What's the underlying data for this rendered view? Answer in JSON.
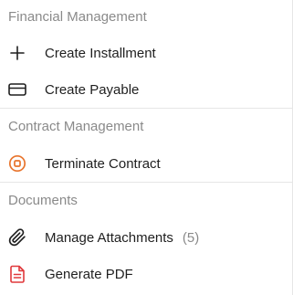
{
  "sections": [
    {
      "header": "Financial Management",
      "items": [
        {
          "label": "Create Installment",
          "icon": "plus-icon"
        },
        {
          "label": "Create Payable",
          "icon": "credit-card-icon"
        }
      ]
    },
    {
      "header": "Contract Management",
      "items": [
        {
          "label": "Terminate Contract",
          "icon": "stop-circle-icon",
          "icon_color": "#e8742c"
        }
      ]
    },
    {
      "header": "Documents",
      "items": [
        {
          "label": "Manage Attachments",
          "count": "(5)",
          "icon": "paperclip-icon"
        },
        {
          "label": "Generate PDF",
          "icon": "file-text-icon",
          "icon_color": "#e0383b"
        }
      ]
    }
  ]
}
